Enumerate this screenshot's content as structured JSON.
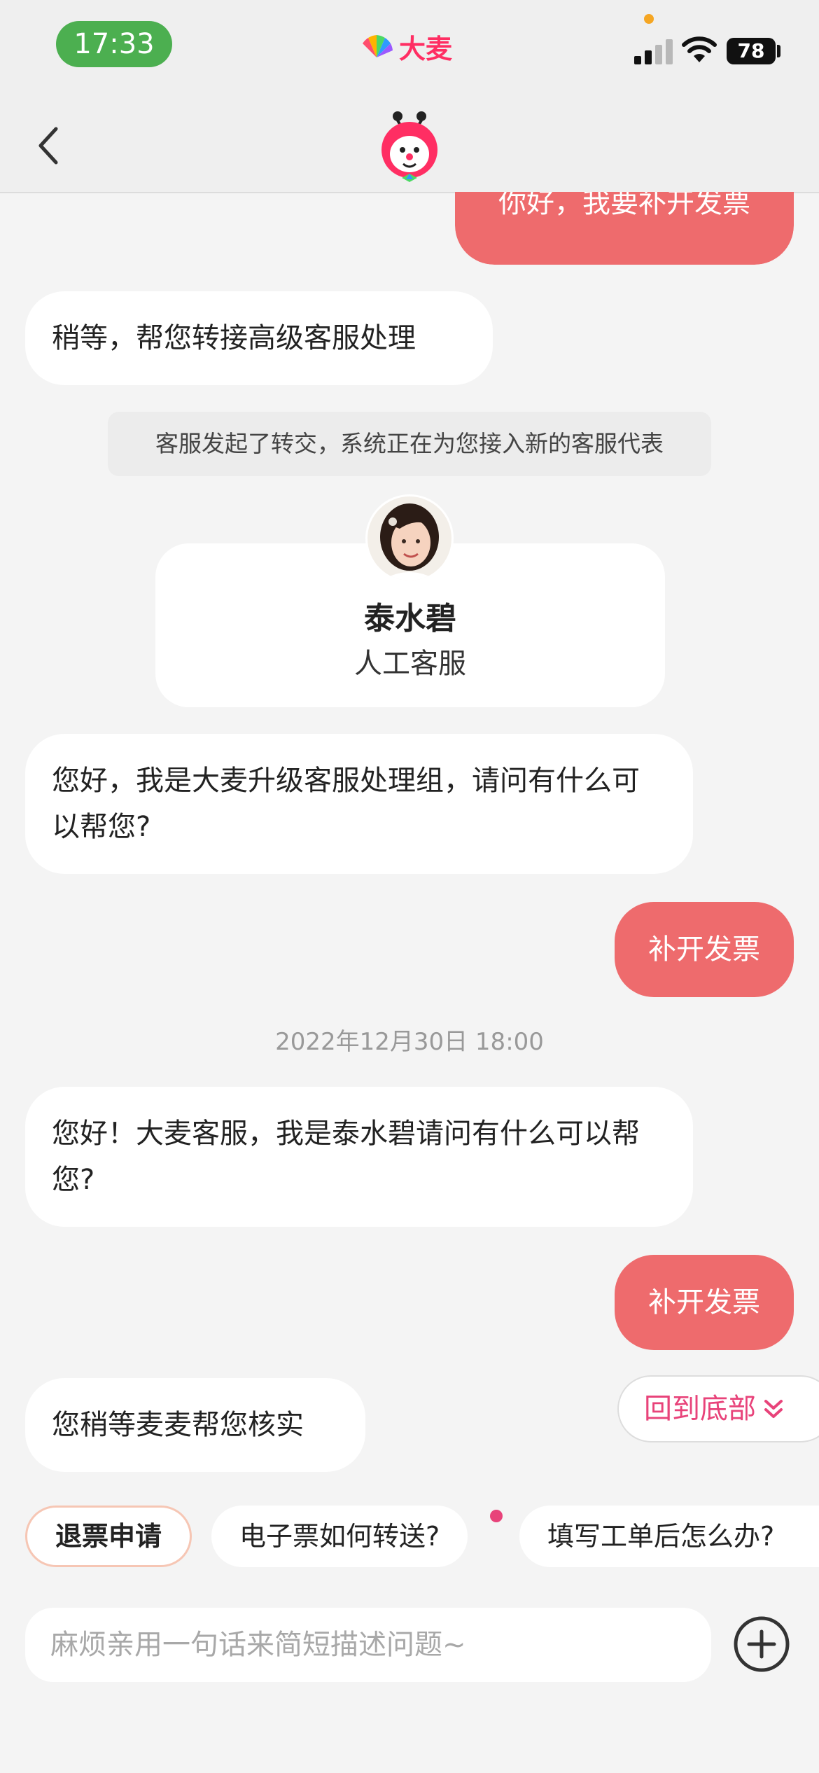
{
  "status_bar": {
    "time": "17:33",
    "battery": "78"
  },
  "app": {
    "brand": "大麦",
    "accent": "#ff2e63"
  },
  "messages": {
    "m1": "你好，我要补开发票",
    "m2": "稍等，帮您转接高级客服处理",
    "system_notice": "客服发起了转交，系统正在为您接入新的客服代表",
    "agent": {
      "name": "泰水碧",
      "role": "人工客服"
    },
    "m3": "您好，我是大麦升级客服处理组，请问有什么可以帮您?",
    "m4": "补开发票",
    "timestamp": "2022年12月30日 18:00",
    "m5": "您好！大麦客服，我是泰水碧请问有什么可以帮您?",
    "m6": "补开发票",
    "m7": "您稍等麦麦帮您核实"
  },
  "back_to_bottom": "回到底部",
  "quick_replies": [
    "退票申请",
    "电子票如何转送?",
    "填写工单后怎么办?"
  ],
  "input": {
    "placeholder": "麻烦亲用一句话来简短描述问题~"
  },
  "colors": {
    "outgoing_bubble": "#ee6b6d",
    "incoming_bubble": "#ffffff",
    "back_to_bottom_text": "#e8437a",
    "time_pill": "#4caf50"
  }
}
